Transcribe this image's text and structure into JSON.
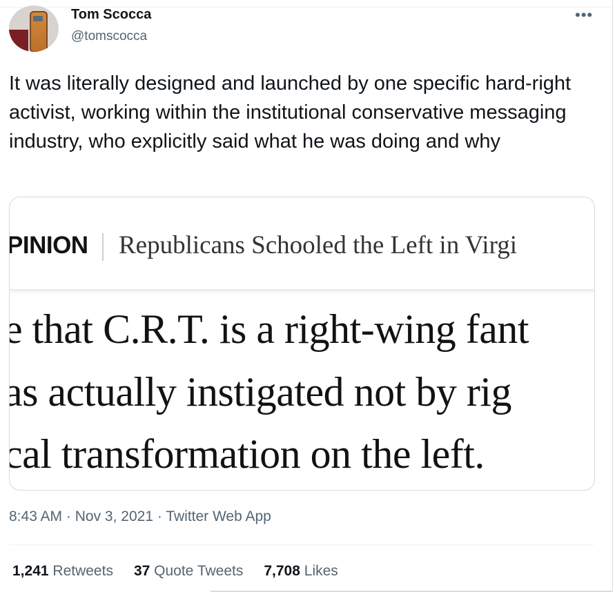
{
  "author": {
    "name": "Tom Scocca",
    "handle": "@tomscocca"
  },
  "more_label": "•••",
  "tweet_text": "It was literally designed and launched by one specific hard-right activist, working within the institutional conservative messaging industry, who explicitly said what he was doing and why",
  "media": {
    "section": "PINION",
    "headline": "Republicans Schooled the Left in Virgi",
    "line1": "e that C.R.T. is a right-wing fant",
    "line2": "as actually instigated not by rig",
    "line3": "cal transformation on the left."
  },
  "meta": {
    "time": "8:43 AM",
    "date": "Nov 3, 2021",
    "source": "Twitter Web App",
    "separator": "·"
  },
  "stats": {
    "retweets_count": "1,241",
    "retweets_label": "Retweets",
    "quotes_count": "37",
    "quotes_label": "Quote Tweets",
    "likes_count": "7,708",
    "likes_label": "Likes"
  }
}
